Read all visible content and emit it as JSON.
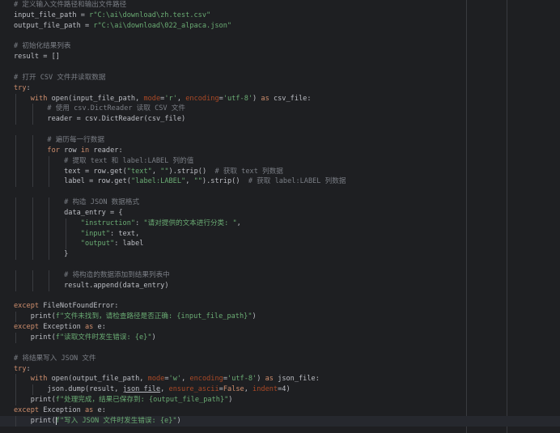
{
  "editor": {
    "lines": [
      "# 定义输入文件路径和输出文件路径",
      "input_file_path = r\"C:\\ai\\download\\zh.test.csv\"",
      "output_file_path = r\"C:\\ai\\download\\022_alpaca.json\"",
      "",
      "# 初始化结果列表",
      "result = []",
      "",
      "# 打开 CSV 文件并读取数据",
      "try:",
      "    with open(input_file_path, mode='r', encoding='utf-8') as csv_file:",
      "        # 使用 csv.DictReader 读取 CSV 文件",
      "        reader = csv.DictReader(csv_file)",
      "",
      "        # 遍历每一行数据",
      "        for row in reader:",
      "            # 提取 text 和 label:LABEL 列的值",
      "            text = row.get(\"text\", \"\").strip()  # 获取 text 列数据",
      "            label = row.get(\"label:LABEL\", \"\").strip()  # 获取 label:LABEL 列数据",
      "",
      "            # 构造 JSON 数据格式",
      "            data_entry = {",
      "                \"instruction\": \"请对提供的文本进行分类: \",",
      "                \"input\": text,",
      "                \"output\": label",
      "            }",
      "",
      "            # 将构造的数据添加到结果列表中",
      "            result.append(data_entry)",
      "",
      "except FileNotFoundError:",
      "    print(f\"文件未找到，请检查路径是否正确: {input_file_path}\")",
      "except Exception as e:",
      "    print(f\"读取文件时发生错误: {e}\")",
      "",
      "# 将结果写入 JSON 文件",
      "try:",
      "    with open(output_file_path, mode='w', encoding='utf-8') as json_file:",
      "        json.dump(result, json_file, ensure_ascii=False, indent=4)",
      "    print(f\"处理完成，结果已保存到: {output_file_path}\")",
      "except Exception as e:",
      "    print(f\"写入 JSON 文件时发生错误: {e}\")"
    ],
    "current_line_index": 40,
    "colors": {
      "background": "#1e1f22",
      "text": "#bcbec4",
      "keyword": "#cf8e6d",
      "string": "#6aab73",
      "comment": "#7a7e85",
      "parameter": "#aa4926",
      "current_line": "#26282e"
    }
  }
}
